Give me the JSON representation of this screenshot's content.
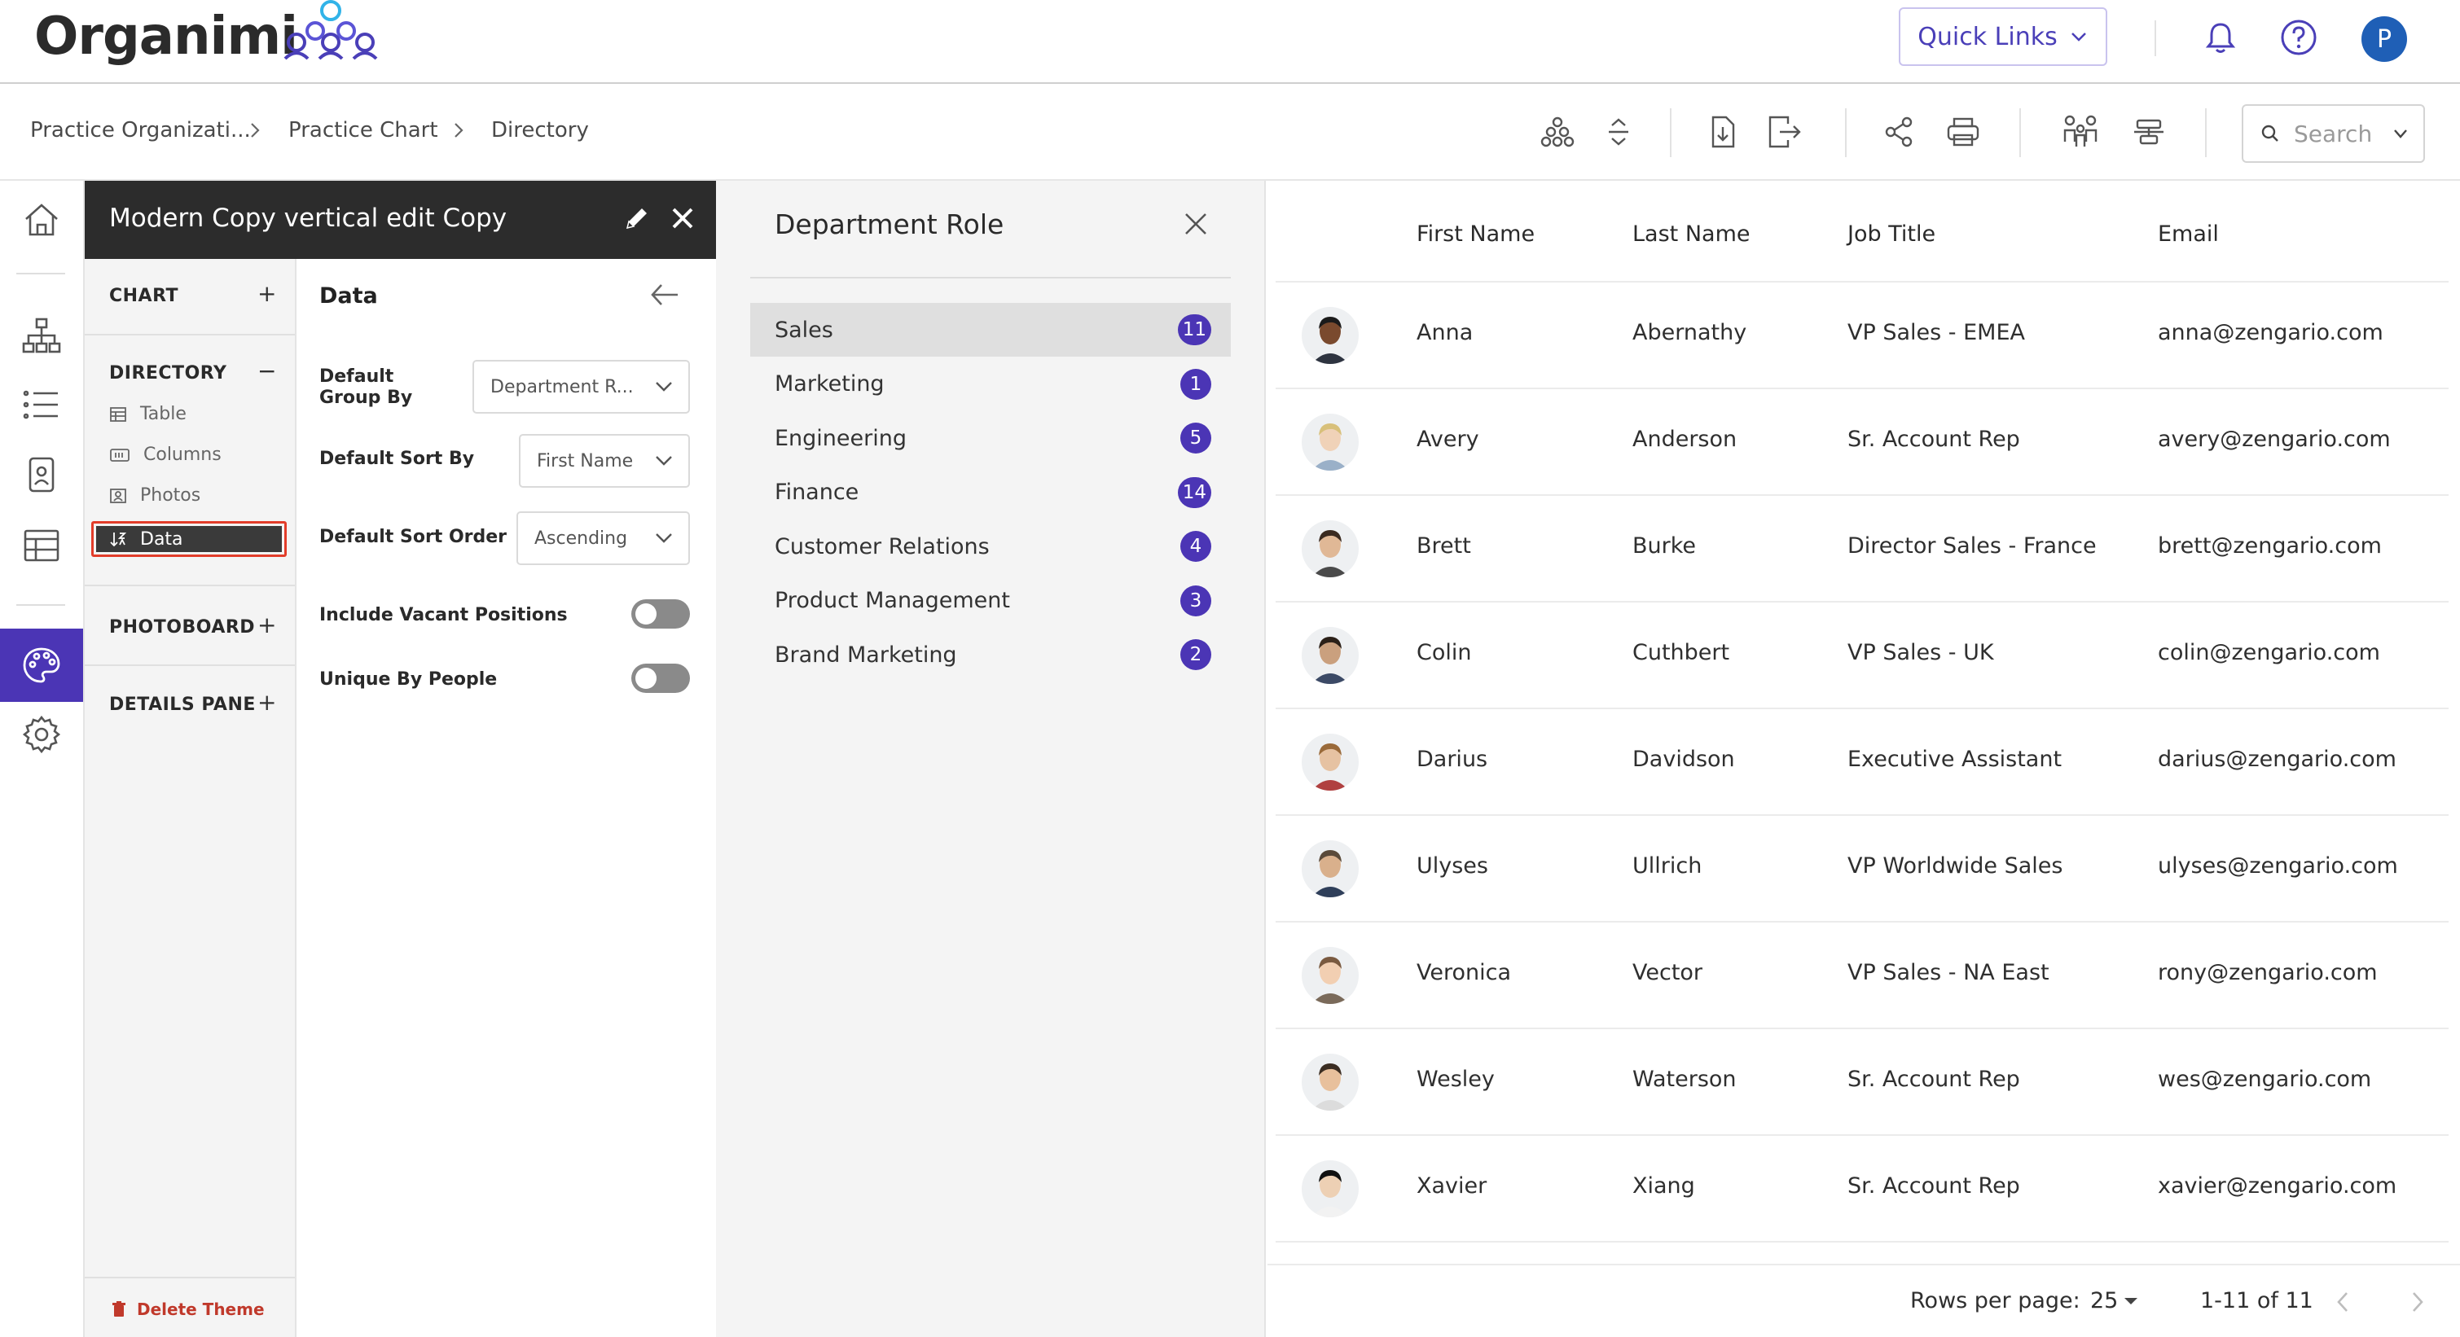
{
  "app": {
    "name": "Organimi"
  },
  "header": {
    "quick_links_label": "Quick Links",
    "avatar_initial": "P",
    "accent_color": "#4a3fb8"
  },
  "breadcrumb": [
    "Practice Organizati...",
    "Practice Chart",
    "Directory"
  ],
  "toolbar": {
    "icons": [
      "org-chart-icon",
      "expand-collapse-icon",
      "import-icon",
      "export-icon",
      "share-icon",
      "print-icon",
      "people-icon",
      "align-icon"
    ],
    "search_placeholder": "Search"
  },
  "rail": {
    "icons": [
      "home-icon",
      "org-chart-icon",
      "list-icon",
      "profile-card-icon",
      "table-icon",
      "palette-icon",
      "gear-icon"
    ],
    "active": "palette-icon"
  },
  "theme": {
    "title": "Modern Copy vertical edit Copy",
    "sections": {
      "chart": "CHART",
      "directory": "DIRECTORY",
      "photoboard": "PHOTOBOARD",
      "details_pane": "DETAILS PANE"
    },
    "directory_items": [
      "Table",
      "Columns",
      "Photos",
      "Data"
    ],
    "selected_item": "Data",
    "delete_label": "Delete Theme"
  },
  "settings": {
    "title": "Data",
    "group_by_label": "Default Group By",
    "group_by_value": "Department R...",
    "sort_by_label": "Default Sort By",
    "sort_by_value": "First Name",
    "sort_order_label": "Default Sort Order",
    "sort_order_value": "Ascending",
    "vacant_label": "Include Vacant Positions",
    "vacant_on": false,
    "unique_label": "Unique By People",
    "unique_on": false
  },
  "department": {
    "title": "Department Role",
    "items": [
      {
        "name": "Sales",
        "count": "11"
      },
      {
        "name": "Marketing",
        "count": "1"
      },
      {
        "name": "Engineering",
        "count": "5"
      },
      {
        "name": "Finance",
        "count": "14"
      },
      {
        "name": "Customer Relations",
        "count": "4"
      },
      {
        "name": "Product Management",
        "count": "3"
      },
      {
        "name": "Brand Marketing",
        "count": "2"
      }
    ],
    "selected": "Sales"
  },
  "table": {
    "columns": [
      "First Name",
      "Last Name",
      "Job Title",
      "Email"
    ],
    "rows": [
      {
        "first": "Anna",
        "last": "Abernathy",
        "title": "VP Sales - EMEA",
        "email": "anna@zengario.com"
      },
      {
        "first": "Avery",
        "last": "Anderson",
        "title": "Sr. Account Rep",
        "email": "avery@zengario.com"
      },
      {
        "first": "Brett",
        "last": "Burke",
        "title": "Director Sales - France",
        "email": "brett@zengario.com"
      },
      {
        "first": "Colin",
        "last": "Cuthbert",
        "title": "VP Sales - UK",
        "email": "colin@zengario.com"
      },
      {
        "first": "Darius",
        "last": "Davidson",
        "title": "Executive Assistant",
        "email": "darius@zengario.com"
      },
      {
        "first": "Ulyses",
        "last": "Ullrich",
        "title": "VP Worldwide Sales",
        "email": "ulyses@zengario.com"
      },
      {
        "first": "Veronica",
        "last": "Vector",
        "title": "VP Sales - NA East",
        "email": "rony@zengario.com"
      },
      {
        "first": "Wesley",
        "last": "Waterson",
        "title": "Sr. Account Rep",
        "email": "wes@zengario.com"
      },
      {
        "first": "Xavier",
        "last": "Xiang",
        "title": "Sr. Account Rep",
        "email": "xavier@zengario.com"
      }
    ],
    "rows_per_page_label": "Rows per page:",
    "rows_per_page": "25",
    "range": "1-11 of 11"
  }
}
